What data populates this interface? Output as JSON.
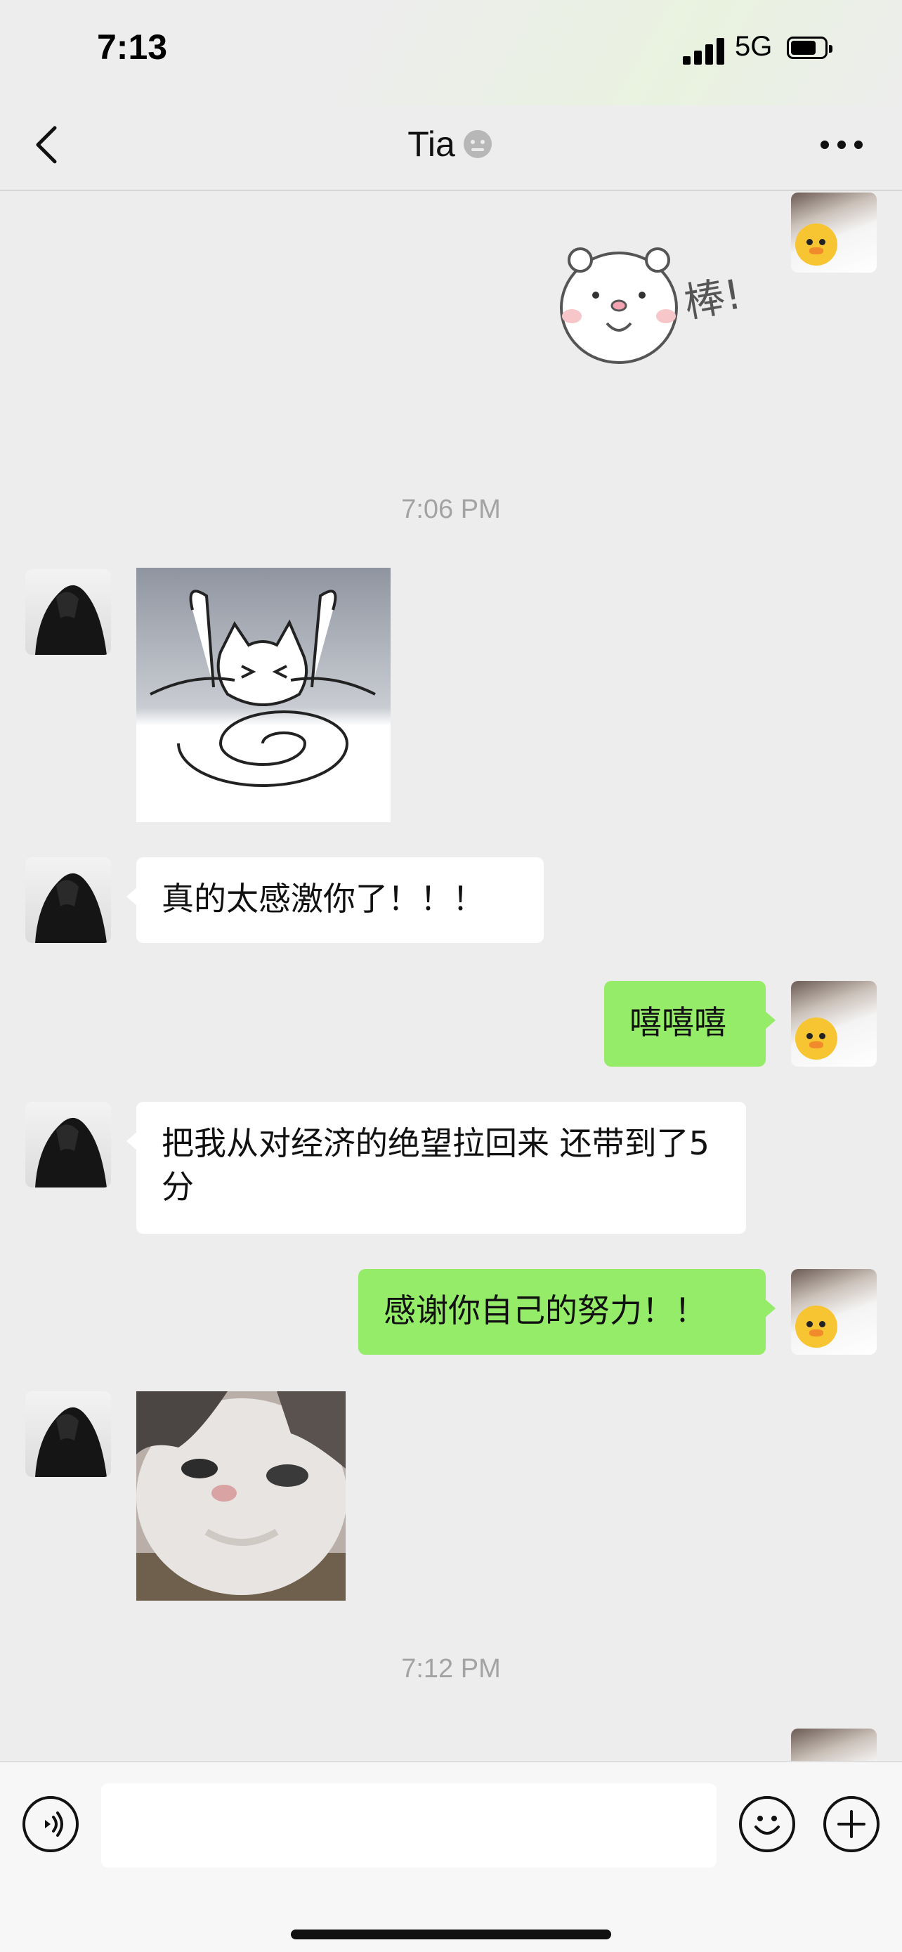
{
  "status_bar": {
    "time": "7:13",
    "network": "5G",
    "battery_level": 0.75
  },
  "nav": {
    "title": "Tia",
    "back_icon": "chevron-left-icon",
    "mute_icon": "muted-notification-icon",
    "more_icon": "more-options-icon"
  },
  "messages": {
    "m1_sticker": "bear-praise-sticker",
    "m1_sticker_text": "棒!",
    "ts1": "7:06 PM",
    "m2_sticker": "crying-cat-sticker",
    "m3_text": "真的太感激你了！！！",
    "m4_text": "嘻嘻嘻",
    "m5_text": "把我从对经济的绝望拉回来 还带到了5分",
    "m6_text": "感谢你自己的努力！！",
    "m7_image": "cat-photo",
    "ts2": "7:12 PM"
  },
  "input_bar": {
    "voice_icon": "voice-input-icon",
    "emoji_icon": "emoji-icon",
    "plus_icon": "plus-icon",
    "message_value": ""
  },
  "colors": {
    "chat_bg": "#ededed",
    "sent_bubble": "#95ec69",
    "received_bubble": "#ffffff"
  }
}
